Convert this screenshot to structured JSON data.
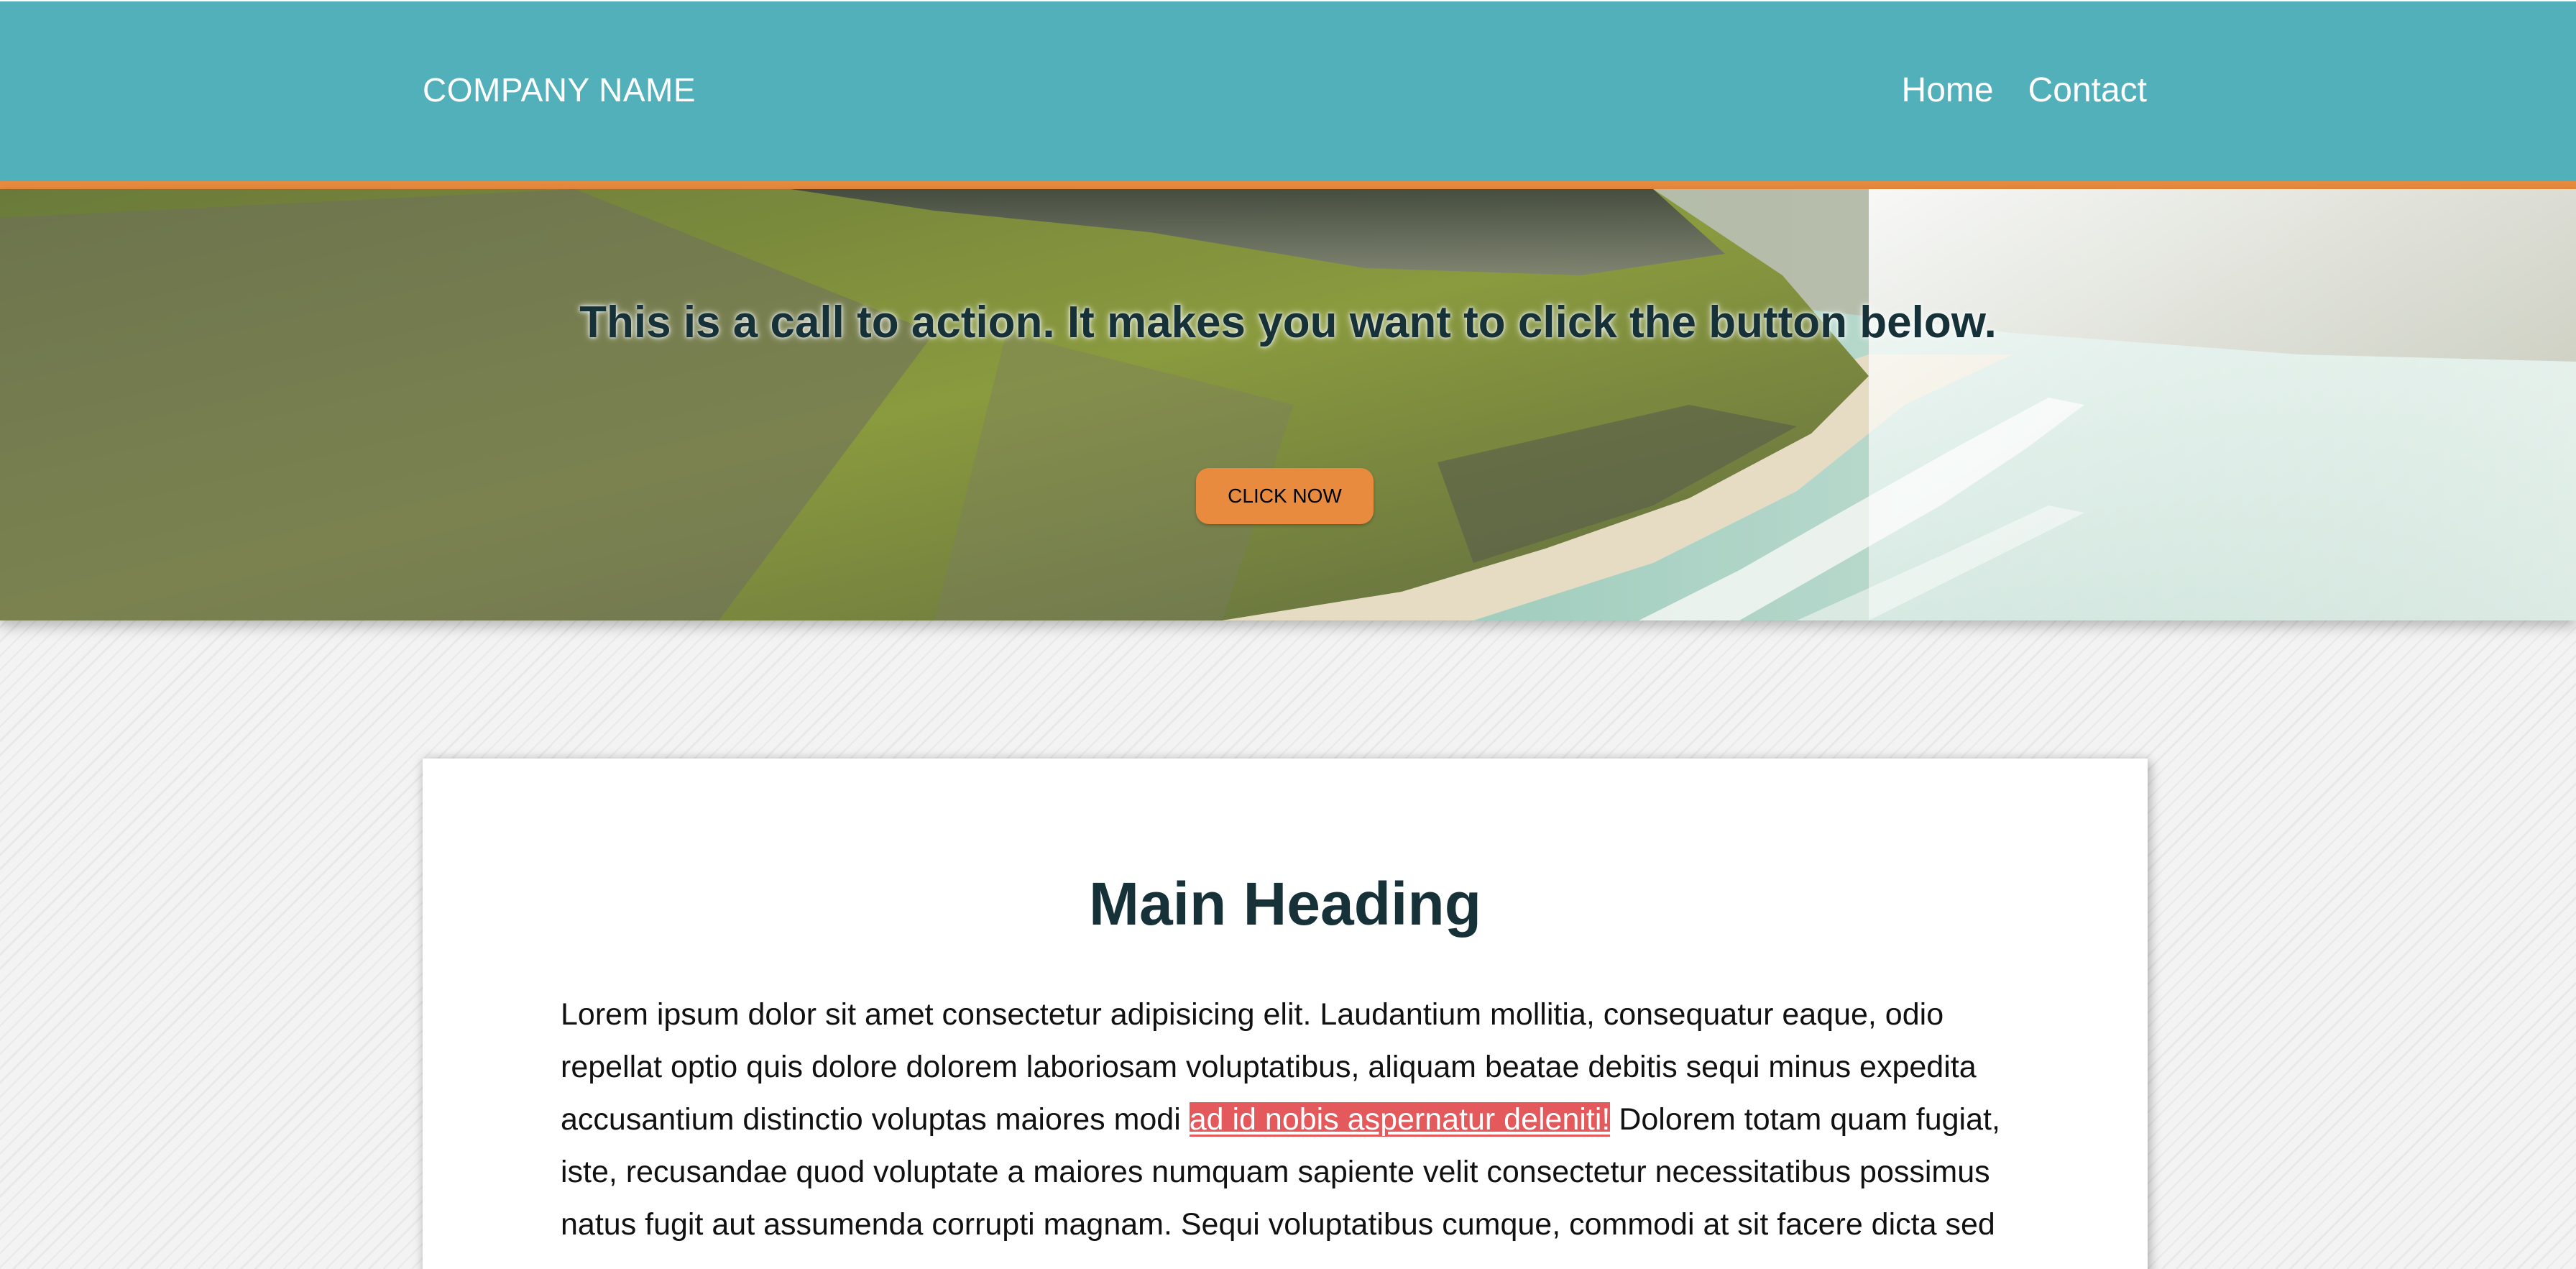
{
  "header": {
    "brand": "COMPANY NAME",
    "nav": [
      "Home",
      "Contact"
    ]
  },
  "hero": {
    "title": "This is a call to action. It makes you want to click the button below.",
    "button_label": "CLICK NOW"
  },
  "main": {
    "heading": "Main Heading",
    "paragraph_before": "Lorem ipsum dolor sit amet consectetur adipisicing elit. Laudantium mollitia, consequatur eaque, odio repellat optio quis dolore dolorem laboriosam voluptatibus, aliquam beatae debitis sequi minus expedita accusantium distinctio voluptas maiores modi ",
    "link_text": "ad id nobis aspernatur deleniti!",
    "paragraph_after": " Dolorem totam quam fugiat, iste, recusandae quod voluptate a maiores numquam sapiente velit consectetur necessitatibus possimus natus fugit aut assumenda corrupti magnam. Sequi voluptatibus cumque, commodi at sit facere dicta sed"
  },
  "colors": {
    "header_bg": "#51b0b9",
    "accent": "#e88b3e",
    "heading_text": "#163238",
    "link_highlight": "#e3595c"
  }
}
